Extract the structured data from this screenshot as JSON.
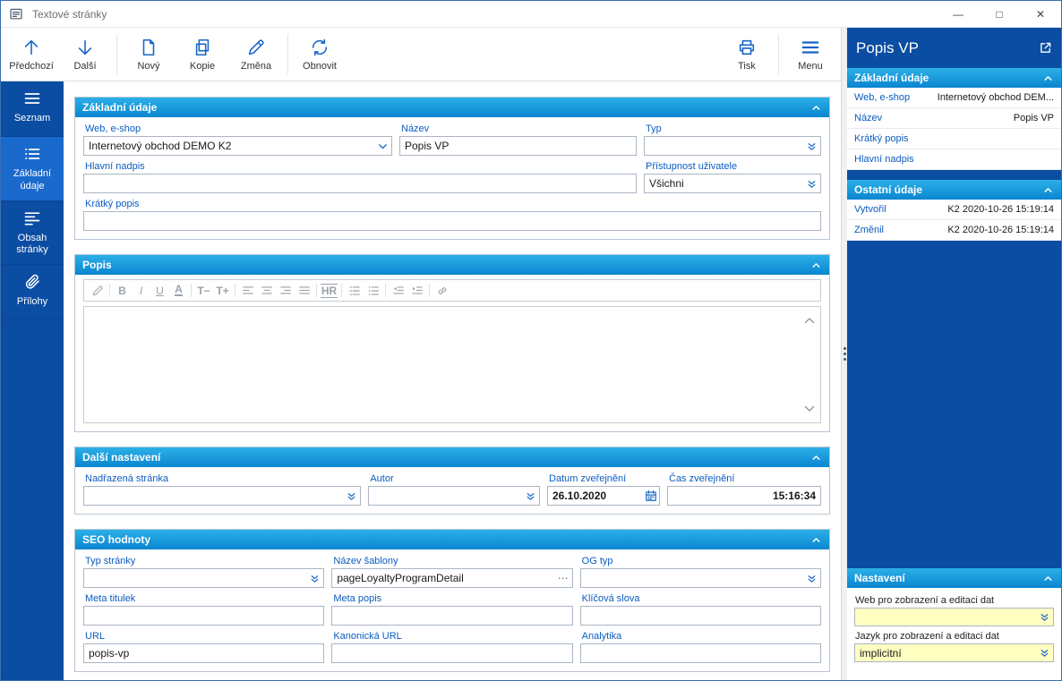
{
  "window": {
    "title": "Textové stránky",
    "controls": {
      "minimize": "—",
      "maximize": "□",
      "close": "✕"
    }
  },
  "toolbar": {
    "nav": [
      {
        "label": "Předchozí",
        "icon": "arrow-up-icon"
      },
      {
        "label": "Další",
        "icon": "arrow-down-icon"
      },
      {
        "label": "Nový",
        "icon": "new-document-icon"
      },
      {
        "label": "Kopie",
        "icon": "copy-document-icon"
      },
      {
        "label": "Změna",
        "icon": "edit-pencil-icon"
      },
      {
        "label": "Obnovit",
        "icon": "refresh-icon"
      }
    ],
    "print": {
      "label": "Tisk",
      "icon": "printer-icon"
    },
    "menu": {
      "label": "Menu",
      "icon": "hamburger-icon"
    }
  },
  "sidebar": {
    "items": [
      {
        "label": "Seznam",
        "icon": "list-icon",
        "active": false
      },
      {
        "label": "Základní údaje",
        "icon": "detail-list-icon",
        "active": true
      },
      {
        "label": "Obsah stránky",
        "icon": "page-content-icon",
        "active": false
      },
      {
        "label": "Přílohy",
        "icon": "paperclip-icon",
        "active": false
      }
    ]
  },
  "main": {
    "basic": {
      "title": "Základní údaje",
      "web_label": "Web, e-shop",
      "web_value": "Internetový obchod DEMO K2",
      "name_label": "Název",
      "name_value": "Popis VP",
      "type_label": "Typ",
      "type_value": "",
      "heading_label": "Hlavní nadpis",
      "heading_value": "",
      "access_label": "Přístupnost uživatele",
      "access_value": "Všichni",
      "short_desc_label": "Krátký popis",
      "short_desc_value": ""
    },
    "description": {
      "title": "Popis",
      "content": "",
      "editor_icons": [
        "edit-pencil-icon",
        "bold-icon",
        "italic-icon",
        "underline-icon",
        "font-color-icon",
        "font-smaller-icon",
        "font-larger-icon",
        "align-left-icon",
        "align-center-icon",
        "align-right-icon",
        "align-justify-icon",
        "horizontal-rule-icon",
        "ordered-list-icon",
        "unordered-list-icon",
        "outdent-icon",
        "indent-icon",
        "link-icon"
      ]
    },
    "other_settings": {
      "title": "Další nastavení",
      "parent_label": "Nadřazená stránka",
      "parent_value": "",
      "author_label": "Autor",
      "author_value": "",
      "publish_date_label": "Datum zveřejnění",
      "publish_date_value": "26.10.2020",
      "publish_time_label": "Čas zveřejnění",
      "publish_time_value": "15:16:34"
    },
    "seo": {
      "title": "SEO hodnoty",
      "page_type_label": "Typ stránky",
      "page_type_value": "",
      "template_label": "Název šablony",
      "template_value": "pageLoyaltyProgramDetail",
      "og_type_label": "OG typ",
      "og_type_value": "",
      "meta_title_label": "Meta titulek",
      "meta_title_value": "",
      "meta_desc_label": "Meta popis",
      "meta_desc_value": "",
      "keywords_label": "Klíčová slova",
      "keywords_value": "",
      "url_label": "URL",
      "url_value": "popis-vp",
      "canonical_label": "Kanonická URL",
      "canonical_value": "",
      "analytics_label": "Analytika",
      "analytics_value": ""
    }
  },
  "right_panel": {
    "title": "Popis VP",
    "basic": {
      "title": "Základní údaje",
      "rows": [
        {
          "label": "Web, e-shop",
          "value": "Internetový obchod DEM..."
        },
        {
          "label": "Název",
          "value": "Popis VP"
        },
        {
          "label": "Krátký popis",
          "value": ""
        },
        {
          "label": "Hlavní nadpis",
          "value": ""
        }
      ]
    },
    "other": {
      "title": "Ostatní údaje",
      "rows": [
        {
          "label": "Vytvořil",
          "value": "K2 2020-10-26 15:19:14"
        },
        {
          "label": "Změnil",
          "value": "K2 2020-10-26 15:19:14"
        }
      ]
    },
    "settings": {
      "title": "Nastavení",
      "web_label": "Web pro zobrazení a editaci dat",
      "web_value": "",
      "language_label": "Jazyk pro zobrazení a editaci dat",
      "language_value": "implicitní"
    }
  },
  "icons": {
    "combo": "double-chevron-down-icon",
    "dropdown": "chevron-down-icon",
    "calendar": "calendar-icon",
    "ellipsis": "ellipsis-icon",
    "collapse": "chevron-up-icon",
    "expand": "open-in-window-icon",
    "splitter": "splitter-dots"
  },
  "colors": {
    "panel_blue": "#0b4da2",
    "active_blue": "#1a6ace",
    "header_gradient_top": "#2cb0e8",
    "header_gradient_bottom": "#0a85d0",
    "label_blue": "#0b5cc0",
    "icon_blue": "#1565c8",
    "highlight_yellow": "#ffffc2"
  }
}
